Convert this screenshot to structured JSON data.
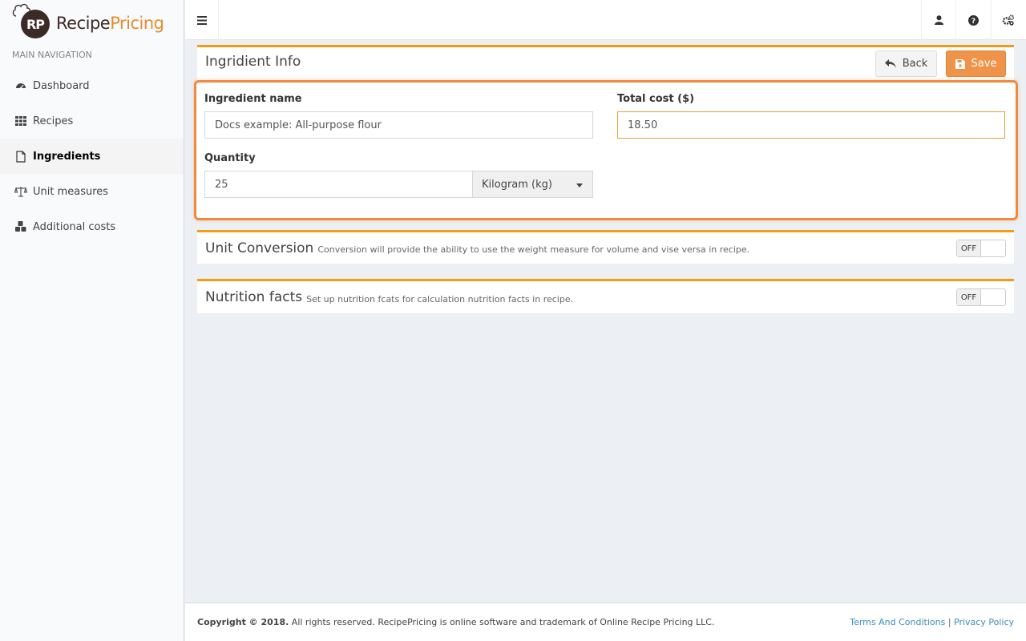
{
  "app": {
    "logo_badge": "RP",
    "logo_part1": "Recipe",
    "logo_part2": "Pricing",
    "brand_color": "#e98a2c"
  },
  "sidebar": {
    "header": "MAIN NAVIGATION",
    "items": [
      {
        "label": "Dashboard",
        "icon": "dashboard-icon"
      },
      {
        "label": "Recipes",
        "icon": "grid-icon"
      },
      {
        "label": "Ingredients",
        "icon": "file-icon",
        "active": true
      },
      {
        "label": "Unit measures",
        "icon": "balance-scale-icon"
      },
      {
        "label": "Additional costs",
        "icon": "cubes-icon"
      }
    ]
  },
  "topbar": {
    "icons": [
      "menu-icon",
      "user-icon",
      "help-icon",
      "settings-icon"
    ]
  },
  "ingredient_box": {
    "title": "Ingridient Info",
    "back_label": "Back",
    "save_label": "Save",
    "name_label": "Ingredient name",
    "name_value": "Docs example: All-purpose flour",
    "cost_label": "Total cost ($)",
    "cost_value": "18.50",
    "quantity_label": "Quantity",
    "quantity_value": "25",
    "unit_value": "Kilogram (kg)"
  },
  "unit_conversion": {
    "title": "Unit Conversion",
    "subtitle": "Conversion will provide the ability to use the weight measure for volume and vise versa in recipe.",
    "toggle_label": "OFF"
  },
  "nutrition": {
    "title": "Nutrition facts",
    "subtitle": "Set up nutrition fcats for calculation nutrition facts in recipe.",
    "toggle_label": "OFF"
  },
  "footer": {
    "copyright_bold": "Copyright © 2018.",
    "copyright_rest": " All rights reserved. RecipePricing is online software and trademark of Online Recipe Pricing LLC.",
    "terms": "Terms And Conditions",
    "separator": "|",
    "privacy": "Privacy Policy"
  }
}
